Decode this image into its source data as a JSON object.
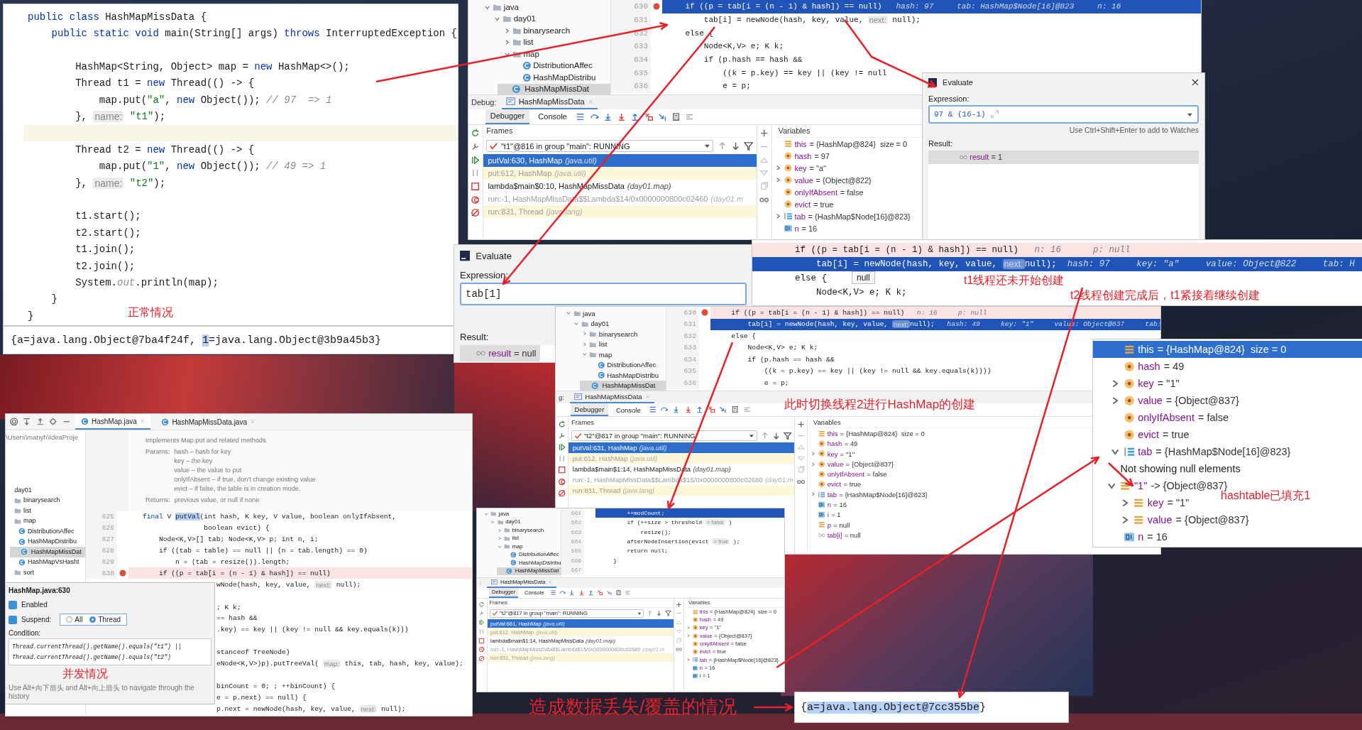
{
  "main_editor": {
    "lines": [
      {
        "current": false,
        "parts": [
          {
            "kind": "keyword",
            "text": "public class "
          },
          {
            "kind": "code",
            "text": "HashMapMissData {"
          }
        ]
      },
      {
        "current": false,
        "parts": [
          {
            "kind": "keyword",
            "text": "    public static void "
          },
          {
            "kind": "code",
            "text": "main(String[] args) "
          },
          {
            "kind": "keyword",
            "text": "throws "
          },
          {
            "kind": "code",
            "text": "InterruptedException {"
          }
        ]
      },
      {
        "current": false
      },
      {
        "current": false,
        "parts": [
          {
            "kind": "code",
            "text": "        HashMap<String, Object> map = "
          },
          {
            "kind": "keyword",
            "text": "new "
          },
          {
            "kind": "code",
            "text": "HashMap<>();"
          }
        ]
      },
      {
        "current": false,
        "parts": [
          {
            "kind": "code",
            "text": "        Thread t1 = "
          },
          {
            "kind": "keyword",
            "text": "new "
          },
          {
            "kind": "code",
            "text": "Thread(() -> {"
          }
        ]
      },
      {
        "current": false,
        "parts": [
          {
            "kind": "code",
            "text": "            map.put("
          },
          {
            "kind": "string",
            "text": "\"a\""
          },
          {
            "kind": "code",
            "text": ", "
          },
          {
            "kind": "keyword",
            "text": "new "
          },
          {
            "kind": "code",
            "text": "Object()); "
          },
          {
            "kind": "comment",
            "text": "// 97  => 1"
          }
        ]
      },
      {
        "current": false,
        "parts": [
          {
            "kind": "code",
            "text": "        }, "
          },
          {
            "kind": "hint",
            "text": "name:"
          },
          {
            "kind": "string",
            "text": " \"t1\""
          },
          {
            "kind": "code",
            "text": ");"
          }
        ]
      },
      {
        "current": true
      },
      {
        "current": false,
        "parts": [
          {
            "kind": "code",
            "text": "        Thread t2 = "
          },
          {
            "kind": "keyword",
            "text": "new "
          },
          {
            "kind": "code",
            "text": "Thread(() -> {"
          }
        ]
      },
      {
        "current": false,
        "parts": [
          {
            "kind": "code",
            "text": "            map.put("
          },
          {
            "kind": "string",
            "text": "\"1\""
          },
          {
            "kind": "code",
            "text": ", "
          },
          {
            "kind": "keyword",
            "text": "new "
          },
          {
            "kind": "code",
            "text": "Object()); "
          },
          {
            "kind": "comment",
            "text": "// 49 => 1"
          }
        ]
      },
      {
        "current": false,
        "parts": [
          {
            "kind": "code",
            "text": "        }, "
          },
          {
            "kind": "hint",
            "text": "name:"
          },
          {
            "kind": "string",
            "text": " \"t2\""
          },
          {
            "kind": "code",
            "text": ");"
          }
        ]
      },
      {
        "current": false
      },
      {
        "current": false,
        "text": "        t1.start();"
      },
      {
        "current": false,
        "text": "        t2.start();"
      },
      {
        "current": false,
        "text": "        t1.join();"
      },
      {
        "current": false,
        "text": "        t2.join();"
      },
      {
        "current": false,
        "parts": [
          {
            "kind": "code",
            "text": "        System."
          },
          {
            "kind": "comment",
            "text": "out"
          },
          {
            "kind": "code",
            "text": ".println(map);"
          }
        ]
      },
      {
        "current": false,
        "text": "    }"
      },
      {
        "current": false,
        "text": "}"
      }
    ],
    "note": "正常情况"
  },
  "main_output": {
    "parts": [
      {
        "kind": "code",
        "text": "{a=java.lang.Object@7ba4f24f, "
      },
      {
        "kind": "selection",
        "text": "1"
      },
      {
        "kind": "code",
        "text": "=java.lang.Object@3b9a45b3}"
      }
    ]
  },
  "debug_window_top": {
    "tree": [
      {
        "label": "java",
        "kind": "folder",
        "expanded": true,
        "selected": false,
        "children": [
          {
            "label": "day01",
            "kind": "folder",
            "expanded": true,
            "selected": false,
            "children": [
              {
                "label": "binarysearch",
                "kind": "folder",
                "expanded": false,
                "selected": false
              },
              {
                "label": "list",
                "kind": "folder",
                "expanded": false,
                "selected": false
              },
              {
                "label": "map",
                "kind": "folder",
                "expanded": true,
                "selected": false,
                "children": [
                  {
                    "label": "DistributionAffec",
                    "kind": "class",
                    "selected": false
                  },
                  {
                    "label": "HashMapDistribu",
                    "kind": "class",
                    "selected": false
                  },
                  {
                    "label": "HashMapMissDat",
                    "kind": "class",
                    "selected": true
                  }
                ]
              }
            ]
          }
        ]
      }
    ],
    "lines": [
      {
        "no": "630",
        "current": true,
        "breakpoint": true,
        "parts": [
          {
            "kind": "code",
            "text": "    if ((p = tab[i = (n - 1) & hash]) == null)   "
          },
          {
            "kind": "value",
            "text": "hash: 97     tab: HashMap$Node[16]@823     n: 16"
          }
        ]
      },
      {
        "no": "631",
        "current": false,
        "breakpoint": false,
        "parts": [
          {
            "kind": "code",
            "text": "        tab[i] = newNode(hash, key, value, "
          },
          {
            "kind": "hint",
            "text": "next:"
          },
          {
            "kind": "code",
            "text": " null);"
          }
        ]
      },
      {
        "no": "632",
        "current": false,
        "breakpoint": false,
        "text": "    else {"
      },
      {
        "no": "633",
        "current": false,
        "breakpoint": false,
        "text": "        Node<K,V> e; K k;"
      },
      {
        "no": "634",
        "current": false,
        "breakpoint": false,
        "text": "        if (p.hash == hash &&"
      },
      {
        "no": "635",
        "current": false,
        "breakpoint": false,
        "text": "            ((k = p.key) == key || (key != null"
      },
      {
        "no": "636",
        "current": false,
        "breakpoint": false,
        "text": "            e = p;"
      }
    ],
    "debug": {
      "label": "Debug:",
      "tab": "HashMapMissData",
      "tabs": [
        {
          "label": "Debugger",
          "selected": true
        },
        {
          "label": "Console",
          "selected": false
        }
      ],
      "frames_header": "Frames",
      "variables_header": "Variables",
      "thread": "\"t1\"@816 in group \"main\": RUNNING",
      "frames": [
        {
          "name": "putVal:630, HashMap",
          "package": "(java.util)",
          "selected": true,
          "kind": "library"
        },
        {
          "name": "put:612, HashMap",
          "package": "(java.util)",
          "selected": false,
          "kind": "library"
        },
        {
          "name": "lambda$main$0:10, HashMapMissData",
          "package": "(day01.map)",
          "selected": false,
          "kind": "user"
        },
        {
          "name": "run:-1, HashMapMissData$$Lambda$14/0x0000000800c02460",
          "package": "(day01.m",
          "selected": false,
          "kind": "synthetic"
        },
        {
          "name": "run:831, Thread",
          "package": "(java.lang)",
          "selected": false,
          "kind": "library"
        }
      ],
      "variables": [
        {
          "kind": "field",
          "name": "this",
          "value": "= {HashMap@824}  size = 0"
        },
        {
          "kind": "param",
          "name": "hash",
          "value": "= 97"
        },
        {
          "kind": "param",
          "name": "key",
          "value": "= \"a\"",
          "expanded": false
        },
        {
          "kind": "param",
          "name": "value",
          "value": "= {Object@822}",
          "expanded": false
        },
        {
          "kind": "param",
          "name": "onlyIfAbsent",
          "value": "= false"
        },
        {
          "kind": "param",
          "name": "evict",
          "value": "= true"
        },
        {
          "kind": "array",
          "name": "tab",
          "value": "= {HashMap$Node[16]@823}",
          "expanded": false
        },
        {
          "kind": "int",
          "name": "n",
          "value": "= 16"
        }
      ]
    }
  },
  "evaluate_dialog_right": {
    "title": "Evaluate",
    "expression_label": "Expression:",
    "expression": "97 & (16-1)",
    "hint": "Use Ctrl+Shift+Enter to add to Watches",
    "result_label": "Result:",
    "result": {
      "name": "result",
      "value": "= 1"
    }
  },
  "evaluate_dialog_left": {
    "title": "Evaluate",
    "expression_label": "Expression:",
    "expression": "tab[1]",
    "result_label": "Result:",
    "result": {
      "name": "result",
      "value": "= null"
    }
  },
  "inline_debug_strip": {
    "lines": [
      {
        "current": false,
        "breakpoint": true,
        "parts": [
          {
            "kind": "code",
            "text": "if ((p = tab[i = (n - 1) & hash]) == null)   "
          },
          {
            "kind": "value",
            "text": "n: 16      p: null"
          }
        ]
      },
      {
        "current": true,
        "breakpoint": false,
        "parts": [
          {
            "kind": "code",
            "text": "    tab[i] = newNode(hash, key, value, "
          },
          {
            "kind": "hint",
            "text": "next:"
          },
          {
            "kind": "code",
            "text": "null);  "
          },
          {
            "kind": "value",
            "text": "hash: 97     key: \"a\"     value: Object@822     tab: H"
          }
        ]
      },
      {
        "current": false,
        "breakpoint": false,
        "text": "else {"
      },
      {
        "current": false,
        "breakpoint": false,
        "text": "    Node<K,V> e; K k;"
      }
    ],
    "tooltip": "null",
    "notes": [
      "t1线程还未开始创建",
      "t2线程创建完成后，t1紧接着继续创建"
    ]
  },
  "debug_window_middle": {
    "tree": [
      {
        "label": "java",
        "kind": "folder",
        "expanded": true,
        "selected": false,
        "children": [
          {
            "label": "day01",
            "kind": "folder",
            "expanded": true,
            "selected": false,
            "children": [
              {
                "label": "binarysearch",
                "kind": "folder",
                "expanded": false,
                "selected": false
              },
              {
                "label": "list",
                "kind": "folder",
                "expanded": false,
                "selected": false
              },
              {
                "label": "map",
                "kind": "folder",
                "expanded": true,
                "selected": false,
                "children": [
                  {
                    "label": "DistributionAffec",
                    "kind": "class",
                    "selected": false
                  },
                  {
                    "label": "HashMapDistribu",
                    "kind": "class",
                    "selected": false
                  },
                  {
                    "label": "HashMapMissDat",
                    "kind": "class",
                    "selected": true
                  }
                ]
              }
            ]
          }
        ]
      }
    ],
    "lines": [
      {
        "no": "630",
        "current": false,
        "breakpoint": true,
        "parts": [
          {
            "kind": "code",
            "text": "    if ((p = tab[i = (n - 1) & hash]) == null)   "
          },
          {
            "kind": "value",
            "text": "n: 16     p: null"
          }
        ]
      },
      {
        "no": "631",
        "current": true,
        "breakpoint": false,
        "parts": [
          {
            "kind": "code",
            "text": "        tab[i] = newNode(hash, key, value, "
          },
          {
            "kind": "hint",
            "text": "next:"
          },
          {
            "kind": "code",
            "text": "null);   "
          },
          {
            "kind": "value",
            "text": "hash: 49     key: \"1\"     value: Object@837     tab:"
          }
        ]
      },
      {
        "no": "632",
        "current": false,
        "breakpoint": false,
        "text": "    else {"
      },
      {
        "no": "633",
        "current": false,
        "breakpoint": false,
        "text": "        Node<K,V> e; K k;"
      },
      {
        "no": "634",
        "current": false,
        "breakpoint": false,
        "text": "        if (p.hash == hash &&"
      },
      {
        "no": "635",
        "current": false,
        "breakpoint": false,
        "text": "            ((k = p.key) == key || (key != null && key.equals(k))))"
      },
      {
        "no": "636",
        "current": false,
        "breakpoint": false,
        "text": "            e = p;"
      }
    ],
    "note": "此时切换线程2进行HashMap的创建",
    "debug": {
      "label": "g:",
      "tab": "HashMapMissData",
      "tabs": [
        {
          "label": "Debugger",
          "selected": true
        },
        {
          "label": "Console",
          "selected": false
        }
      ],
      "frames_header": "Frames",
      "variables_header": "Variables",
      "thread": "\"t2\"@817 in group \"main\": RUNNING",
      "frames": [
        {
          "name": "putVal:631, HashMap",
          "package": "(java.util)",
          "selected": true,
          "kind": "library"
        },
        {
          "name": "put:612, HashMap",
          "package": "(java.util)",
          "selected": false,
          "kind": "library"
        },
        {
          "name": "lambda$main$1:14, HashMapMissData",
          "package": "(day01.map)",
          "selected": false,
          "kind": "user"
        },
        {
          "name": "run:-1, HashMapMissData$$Lambda$15/0x0000000800c02680",
          "package": "(day01.m",
          "selected": false,
          "kind": "synthetic"
        },
        {
          "name": "run:831, Thread",
          "package": "(java.lang)",
          "selected": false,
          "kind": "library"
        }
      ],
      "variables": [
        {
          "kind": "field",
          "name": "this",
          "value": "= {HashMap@824}  size = 0"
        },
        {
          "kind": "param",
          "name": "hash",
          "value": "= 49"
        },
        {
          "kind": "param",
          "name": "key",
          "value": "= \"1\"",
          "expanded": false
        },
        {
          "kind": "param",
          "name": "value",
          "value": "= {Object@837}",
          "expanded": false
        },
        {
          "kind": "param",
          "name": "onlyIfAbsent",
          "value": "= false"
        },
        {
          "kind": "param",
          "name": "evict",
          "value": "= true"
        },
        {
          "kind": "array",
          "name": "tab",
          "value": "= {HashMap$Node[16]@823}",
          "expanded": false
        },
        {
          "kind": "int",
          "name": "n",
          "value": "= 16"
        },
        {
          "kind": "int",
          "name": "i",
          "value": "= 1"
        },
        {
          "kind": "field",
          "name": "p",
          "value": "= null"
        },
        {
          "kind": "watch",
          "name": "tab[i]",
          "value": "= null"
        }
      ]
    }
  },
  "debug_window_small": {
    "tree": [
      {
        "label": "java",
        "kind": "folder",
        "expanded": true,
        "selected": false,
        "children": [
          {
            "label": "day01",
            "kind": "folder",
            "expanded": true,
            "selected": false,
            "children": [
              {
                "label": "binarysearch",
                "kind": "folder",
                "expanded": false,
                "selected": false
              },
              {
                "label": "list",
                "kind": "folder",
                "expanded": false,
                "selected": false
              },
              {
                "label": "map",
                "kind": "folder",
                "expanded": true,
                "selected": false,
                "children": [
                  {
                    "label": "DistributionAffec",
                    "kind": "class",
                    "selected": false
                  },
                  {
                    "label": "HashMapDistribu",
                    "kind": "class",
                    "selected": false
                  },
                  {
                    "label": "HashMapMissDat",
                    "kind": "class",
                    "selected": true
                  }
                ]
              }
            ]
          }
        ]
      }
    ],
    "lines": [
      {
        "no": "661",
        "current": true,
        "breakpoint": false,
        "text": "        ++modCount;"
      },
      {
        "no": "662",
        "current": false,
        "breakpoint": false,
        "parts": [
          {
            "kind": "code",
            "text": "        if (++size > threshold "
          },
          {
            "kind": "hint",
            "text": "= false"
          },
          {
            "kind": "code",
            "text": " )"
          }
        ]
      },
      {
        "no": "663",
        "current": false,
        "breakpoint": false,
        "text": "            resize();"
      },
      {
        "no": "664",
        "current": false,
        "breakpoint": false,
        "parts": [
          {
            "kind": "code",
            "text": "        afterNodeInsertion(evict "
          },
          {
            "kind": "hint",
            "text": "= true"
          },
          {
            "kind": "code",
            "text": " );"
          }
        ]
      },
      {
        "no": "665",
        "current": false,
        "breakpoint": false,
        "text": "        return null;"
      },
      {
        "no": "666",
        "current": false,
        "breakpoint": false,
        "text": "    }"
      },
      {
        "no": "667",
        "current": false,
        "breakpoint": false
      }
    ],
    "debug": {
      "label": ":",
      "tab": "HashMapMissData",
      "tabs": [
        {
          "label": "Debugger",
          "selected": true
        },
        {
          "label": "Console",
          "selected": false
        }
      ],
      "frames_header": "Frames",
      "variables_header": "Variables",
      "thread": "\"t2\"@817 in group \"main\": RUNNING",
      "frames": [
        {
          "name": "putVal:661, HashMap",
          "package": "(java.util)",
          "selected": true,
          "kind": "library"
        },
        {
          "name": "put:612, HashMap",
          "package": "(java.util)",
          "selected": false,
          "kind": "library"
        },
        {
          "name": "lambda$main$1:14, HashMapMissData",
          "package": "(day01.map)",
          "selected": false,
          "kind": "user"
        },
        {
          "name": "run:-1, HashMapMissData$$Lambda$15/0x0000000800c02680",
          "package": "(day01.m",
          "selected": false,
          "kind": "synthetic"
        },
        {
          "name": "run:831, Thread",
          "package": "(java.lang)",
          "selected": false,
          "kind": "library"
        }
      ],
      "variables": [
        {
          "kind": "field",
          "name": "this",
          "value": "= {HashMap@824}  size = 0"
        },
        {
          "kind": "param",
          "name": "hash",
          "value": "= 49"
        },
        {
          "kind": "param",
          "name": "key",
          "value": "= \"1\"",
          "expanded": false
        },
        {
          "kind": "param",
          "name": "value",
          "value": "= {Object@837}",
          "expanded": false
        },
        {
          "kind": "param",
          "name": "onlyIfAbsent",
          "value": "= false"
        },
        {
          "kind": "param",
          "name": "evict",
          "value": "= true"
        },
        {
          "kind": "array",
          "name": "tab",
          "value": "= {HashMap$Node[16]@823}",
          "expanded": false
        },
        {
          "kind": "int",
          "name": "n",
          "value": "= 16"
        },
        {
          "kind": "int",
          "name": "i",
          "value": "= 1"
        }
      ]
    }
  },
  "editor_bottom_left": {
    "tabs": [
      {
        "label": "HashMap.java",
        "selected": true
      },
      {
        "label": "HashMapMissData.java",
        "selected": false
      }
    ],
    "path": "\\Users\\manyh\\IdeaProje",
    "tree": [
      {
        "label": "day01",
        "kind": "module",
        "selected": false
      },
      {
        "label": "binarysearch",
        "kind": "folder",
        "selected": false
      },
      {
        "label": "list",
        "kind": "folder",
        "selected": false
      },
      {
        "label": "map",
        "kind": "folder",
        "selected": false,
        "children": [
          {
            "label": "DistributionAffec",
            "kind": "class",
            "selected": false
          },
          {
            "label": "HashMapDistribu",
            "kind": "class",
            "selected": false
          },
          {
            "label": "HashMapMissDat",
            "kind": "class",
            "selected": true
          },
          {
            "label": "HashMapVsHasht",
            "kind": "class",
            "selected": false
          }
        ]
      },
      {
        "label": "sort",
        "kind": "folder",
        "selected": false
      }
    ],
    "doc": {
      "summary": "Implements Map.put and related methods.",
      "sections": [
        {
          "label": "Params:",
          "items": [
            "hash – hash for key",
            "key – the key",
            "value – the value to put",
            "onlyIfAbsent – if true, don't change existing value",
            "evict – if false, the table is in creation mode."
          ]
        },
        {
          "label": "Returns:",
          "items": [
            "previous value, or null if none"
          ]
        }
      ]
    },
    "lines": [
      {
        "no": "625",
        "current": false,
        "breakpoint": false,
        "parts": [
          {
            "kind": "keyword",
            "text": "final "
          },
          {
            "kind": "code",
            "text": "V "
          },
          {
            "kind": "selection",
            "text": "putVal"
          },
          {
            "kind": "code",
            "text": "(int hash, K key, V value, boolean onlyIfAbsent,"
          }
        ]
      },
      {
        "no": "626",
        "current": false,
        "breakpoint": false,
        "text": "               boolean evict) {"
      },
      {
        "no": "627",
        "current": false,
        "breakpoint": false,
        "text": "    Node<K,V>[] tab; Node<K,V> p; int n, i;"
      },
      {
        "no": "628",
        "current": false,
        "breakpoint": false,
        "text": "    if ((tab = table) == null || (n = tab.length) == 0)"
      },
      {
        "no": "629",
        "current": false,
        "breakpoint": false,
        "text": "        n = (tab = resize()).length;"
      },
      {
        "no": "630",
        "current": false,
        "breakpoint": true,
        "text": "    if ((p = tab[i = (n - 1) & hash]) == null)"
      }
    ],
    "covered_lines": [
      {
        "parts": [
          {
            "kind": "code",
            "text": "wNode(hash, key, value, "
          },
          {
            "kind": "hint",
            "text": "next:"
          },
          {
            "kind": "code",
            "text": " null);"
          }
        ]
      },
      {
        "text": "; K k;"
      },
      {
        "text": "== hash &&"
      },
      {
        "text": ".key) == key || (key != null && key.equals(k)))"
      },
      {
        "text": "stanceof TreeNode)"
      },
      {
        "parts": [
          {
            "kind": "code",
            "text": "eNode<K,V>)p).putTreeVal( "
          },
          {
            "kind": "hint",
            "text": "map:"
          },
          {
            "kind": "code",
            "text": " this, tab, hash, key, value);"
          }
        ]
      },
      {
        "text": "binCount = 0; ; ++binCount) {"
      },
      {
        "text": "e = p.next) == null) {"
      },
      {
        "parts": [
          {
            "kind": "code",
            "text": "p.next = newNode(hash, key, value, "
          },
          {
            "kind": "hint",
            "text": "next:"
          },
          {
            "kind": "code",
            "text": " null);"
          }
        ]
      }
    ],
    "breakpoint_popup": {
      "title": "HashMap.java:630",
      "enabled": {
        "label": "Enabled",
        "checked": true
      },
      "suspend": {
        "label": "Suspend:",
        "checked": true
      },
      "options": [
        {
          "label": "All",
          "selected": false
        },
        {
          "label": "Thread",
          "selected": true
        }
      ],
      "condition_label": "Condition:",
      "condition": [
        "Thread.currentThread().getName().equals(\"t1\") ||",
        "Thread.currentThread().getName().equals(\"t2\")"
      ],
      "note": "并发情况",
      "footer": "Use Alt+向下箭头 and Alt+向上箭头 to navigate through the history"
    }
  },
  "variables_closeup": {
    "variables": [
      {
        "kind": "field",
        "name": "this",
        "value": "= {HashMap@824}  size = 0",
        "selected": true
      },
      {
        "kind": "param",
        "name": "hash",
        "value": "= 49",
        "selected": false
      },
      {
        "kind": "param",
        "name": "key",
        "value": "= \"1\"",
        "expanded": false,
        "selected": false
      },
      {
        "kind": "param",
        "name": "value",
        "value": "= {Object@837}",
        "expanded": false,
        "selected": false
      },
      {
        "kind": "param",
        "name": "onlyIfAbsent",
        "value": "= false",
        "selected": false
      },
      {
        "kind": "param",
        "name": "evict",
        "value": "= true",
        "selected": false
      },
      {
        "kind": "array",
        "name": "tab",
        "value": "= {HashMap$Node[16]@823}",
        "expanded": true,
        "selected": false,
        "children": [
          {
            "kind": "message",
            "text": "Not showing null elements",
            "selected": false
          },
          {
            "kind": "field",
            "name": "\"1\"",
            "value": "-> {Object@837}",
            "expanded": true,
            "selected": false,
            "children": [
              {
                "kind": "field",
                "name": "key",
                "value": "= \"1\"",
                "expanded": false,
                "selected": false
              },
              {
                "kind": "field",
                "name": "value",
                "value": "= {Object@837}",
                "expanded": false,
                "selected": false
              }
            ]
          }
        ]
      },
      {
        "kind": "int",
        "name": "n",
        "value": "= 16",
        "selected": false
      }
    ],
    "note": "hashtable已填充1"
  },
  "result_output": {
    "parts": [
      {
        "kind": "code",
        "text": "{"
      },
      {
        "kind": "selection",
        "text": "a=java.lang.Object@7cc355be"
      },
      {
        "kind": "code",
        "text": "}"
      }
    ]
  },
  "bottom_note": "造成数据丢失/覆盖的情况"
}
